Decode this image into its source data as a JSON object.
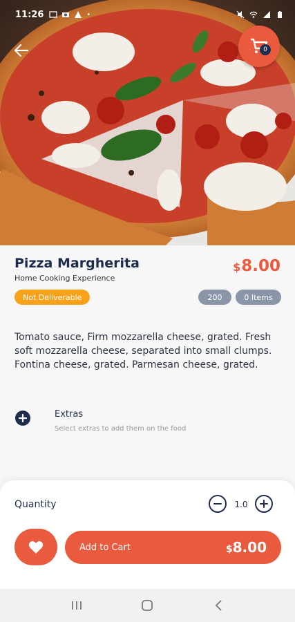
{
  "status_bar": {
    "time": "11:26"
  },
  "product": {
    "title": "Pizza Margherita",
    "subtitle": "Home Cooking Experience",
    "price_currency": "$",
    "price_amount": "8.00",
    "deliverable_badge": "Not Deliverable",
    "chip_count": "200",
    "chip_items": "0 Items",
    "description": "Tomato sauce, Firm mozzarella cheese, grated. Fresh soft mozzarella cheese, separated into small clumps. Fontina cheese, grated. Parmesan cheese, grated."
  },
  "cart_fab": {
    "badge_count": "0"
  },
  "extras": {
    "title": "Extras",
    "subtitle": "Select extras to add them on the food"
  },
  "quantity": {
    "label": "Quantity",
    "value": "1.0"
  },
  "add_to_cart": {
    "label": "Add to Cart",
    "price_currency": "$",
    "price_amount": "8.00"
  },
  "colors": {
    "accent": "#ea5a3e",
    "navy": "#1f2d4d",
    "warning": "#f8a11a",
    "chip": "#8a96a8"
  },
  "icons": [
    "back-arrow-icon",
    "cart-icon",
    "plus-circle-icon",
    "minus-circle-icon",
    "heart-icon",
    "recents-icon",
    "home-icon",
    "back-nav-icon"
  ]
}
